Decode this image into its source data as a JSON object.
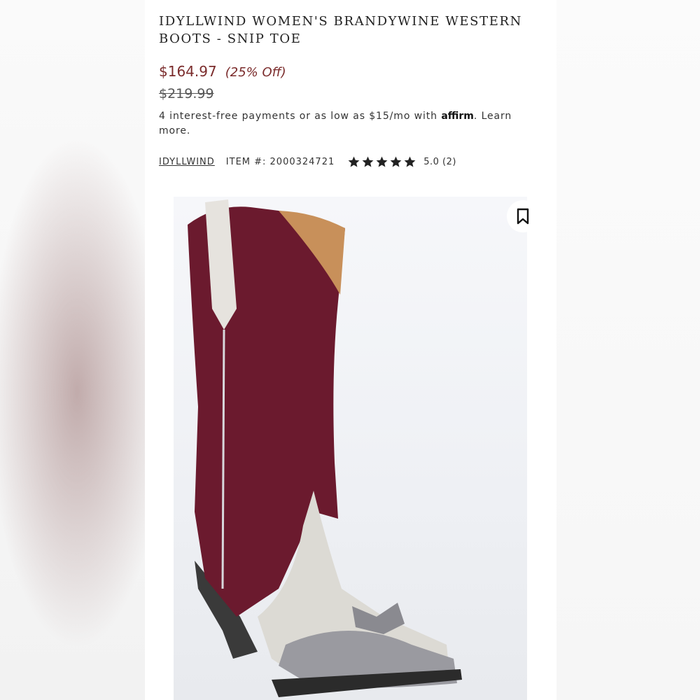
{
  "product": {
    "title": "IDYLLWIND WOMEN'S BRANDYWINE WESTERN BOOTS - SNIP TOE",
    "price": "$164.97",
    "discount": "(25% Off)",
    "original_price": "$219.99",
    "affirm_text": "4 interest-free payments or as low as $15/mo with ",
    "affirm_logo": "affirm",
    "affirm_suffix": ". ",
    "learn_more": "Learn more.",
    "brand": "IDYLLWIND",
    "item_number": "ITEM #: 2000324721",
    "rating_value": 5,
    "rating_text": "5.0 (2)"
  },
  "icons": {
    "star": "star-icon",
    "bookmark": "bookmark-icon"
  },
  "colors": {
    "price": "#7b2c2c",
    "boot_shaft": "#6b1a2e",
    "star": "#222222"
  }
}
